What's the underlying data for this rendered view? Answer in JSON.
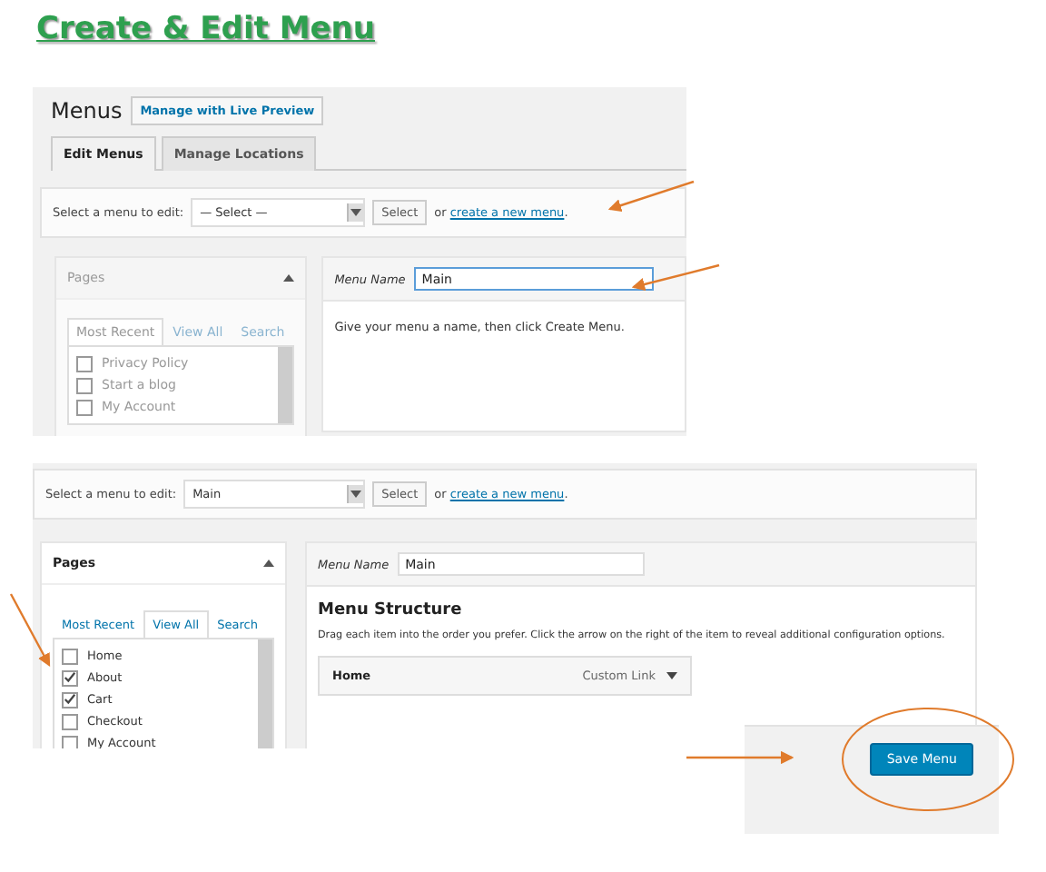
{
  "title": "Create & Edit Menu",
  "shot_1": {
    "heading": "Menus",
    "live_preview_button": "Manage with Live Preview",
    "tabs": [
      {
        "label": "Edit Menus",
        "selected": true
      },
      {
        "label": "Manage Locations",
        "selected": false
      }
    ],
    "select_row": {
      "label": "Select a menu to edit:",
      "value": "— Select —",
      "button": "Select",
      "before_link": "or ",
      "link": "create a new menu",
      "after_link": "."
    },
    "pages_box": {
      "title": "Pages",
      "tabs": [
        {
          "label": "Most Recent",
          "selected": true
        },
        {
          "label": "View All",
          "selected": false
        },
        {
          "label": "Search",
          "selected": false
        }
      ],
      "items": [
        {
          "label": "Privacy Policy",
          "checked": false
        },
        {
          "label": "Start a blog",
          "checked": false
        },
        {
          "label": "My Account",
          "checked": false
        }
      ]
    },
    "menu_name": {
      "label": "Menu Name",
      "value": "Main"
    },
    "hint": "Give your menu a name, then click Create Menu."
  },
  "shot_2": {
    "select_row": {
      "label": "Select a menu to edit:",
      "value": "Main",
      "button": "Select",
      "before_link": "or ",
      "link": "create a new menu",
      "after_link": "."
    },
    "pages_box": {
      "title": "Pages",
      "tabs": [
        {
          "label": "Most Recent",
          "selected": false
        },
        {
          "label": "View All",
          "selected": true
        },
        {
          "label": "Search",
          "selected": false
        }
      ],
      "items": [
        {
          "label": "Home",
          "checked": false
        },
        {
          "label": "About",
          "checked": true
        },
        {
          "label": "Cart",
          "checked": true
        },
        {
          "label": "Checkout",
          "checked": false
        },
        {
          "label": "My Account",
          "checked": false
        }
      ]
    },
    "menu_name": {
      "label": "Menu Name",
      "value": "Main"
    },
    "structure_title": "Menu Structure",
    "structure_hint": "Drag each item into the order you prefer. Click the arrow on the right of the item to reveal additional configuration options.",
    "menu_items": [
      {
        "title": "Home",
        "type": "Custom Link"
      }
    ]
  },
  "save_panel": {
    "button": "Save Menu"
  }
}
